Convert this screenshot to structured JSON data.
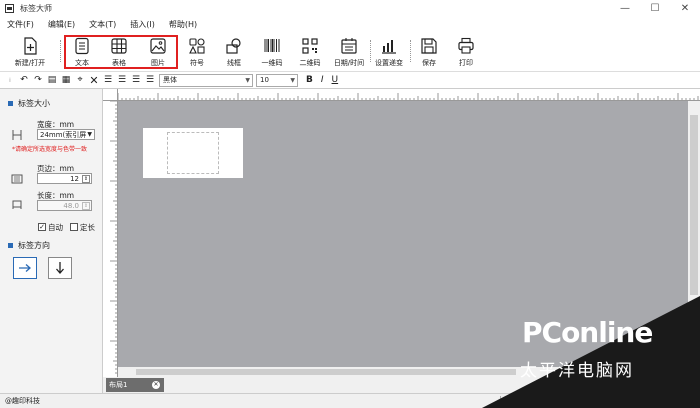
{
  "window": {
    "title": "标签大师",
    "controls": [
      "—",
      "☐",
      "✕"
    ]
  },
  "menu": [
    "文件(F)",
    "编辑(E)",
    "文本(T)",
    "插入(I)",
    "帮助(H)"
  ],
  "toolbar": [
    {
      "id": "new-open",
      "label": "新建/打开",
      "icon": "new-file-icon"
    },
    {
      "id": "text",
      "label": "文本",
      "icon": "text-icon"
    },
    {
      "id": "table",
      "label": "表格",
      "icon": "table-icon"
    },
    {
      "id": "image",
      "label": "图片",
      "icon": "image-icon"
    },
    {
      "id": "symbol",
      "label": "符号",
      "icon": "symbol-icon"
    },
    {
      "id": "frame",
      "label": "线框",
      "icon": "shape-icon"
    },
    {
      "id": "barcode",
      "label": "一维码",
      "icon": "barcode-icon"
    },
    {
      "id": "qrcode",
      "label": "二维码",
      "icon": "qrcode-icon"
    },
    {
      "id": "datetime",
      "label": "日期/时间",
      "icon": "calendar-icon"
    },
    {
      "id": "increment",
      "label": "设置递变",
      "icon": "bar-chart-icon"
    },
    {
      "id": "save",
      "label": "保存",
      "icon": "save-icon"
    },
    {
      "id": "print",
      "label": "打印",
      "icon": "printer-icon"
    }
  ],
  "format": {
    "font_family": "黑体",
    "font_size": "10",
    "bold": "B",
    "italic": "I",
    "underline": "U"
  },
  "left_panel": {
    "label_size_title": "标签大小",
    "width_label": "宽度：mm",
    "width_value": "24mm(索引屏",
    "hint": "*请确定所选宽度与色带一致",
    "margin_label": "页边：mm",
    "margin_value": "12",
    "length_label": "长度：mm",
    "length_value": "48.0",
    "auto_label": "自动",
    "auto_checked": true,
    "fixed_label": "定长",
    "fixed_checked": false,
    "direction_title": "标签方向"
  },
  "tabs": [
    {
      "label": "布局1"
    }
  ],
  "status": {
    "text": "@趣印科技"
  },
  "watermark": {
    "brand": "PConline",
    "sub": "太平洋电脑网"
  }
}
